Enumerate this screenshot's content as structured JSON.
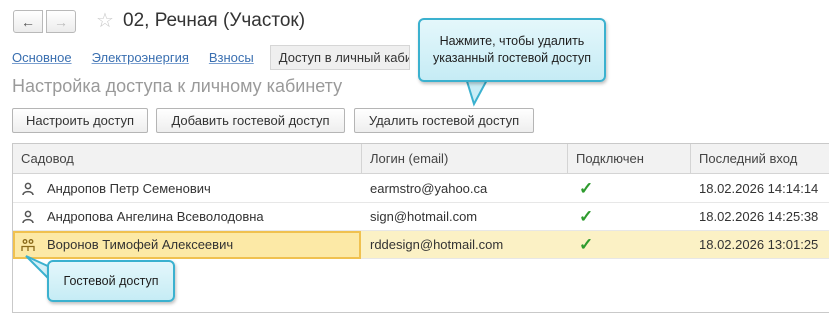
{
  "window": {
    "title": "02, Речная (Участок)",
    "back_icon": "←",
    "forward_icon": "→",
    "star_icon": "☆"
  },
  "tabs": [
    {
      "label": "Основное"
    },
    {
      "label": "Электроэнергия"
    },
    {
      "label": "Взносы"
    },
    {
      "label": "Доступ в личный кабинет"
    }
  ],
  "section_title": "Настройка доступа к личному кабинету",
  "toolbar": {
    "configure_label": "Настроить доступ",
    "add_guest_label": "Добавить гостевой доступ",
    "delete_guest_label": "Удалить гостевой доступ"
  },
  "table": {
    "columns": [
      "Садовод",
      "Логин (email)",
      "Подключен",
      "Последний вход"
    ],
    "rows": [
      {
        "name": "Андропов Петр Семенович",
        "login": "earmstro@yahoo.ca",
        "connected": "✓",
        "last_login": "18.02.2026 14:14:14",
        "icon": "user-icon"
      },
      {
        "name": "Андропова Ангелина Всеволодовна",
        "login": "sign@hotmail.com",
        "connected": "✓",
        "last_login": "18.02.2026 14:25:38",
        "icon": "user-icon"
      },
      {
        "name": "Воронов Тимофей Алексеевич",
        "login": "rddesign@hotmail.com",
        "connected": "✓",
        "last_login": "18.02.2026 13:01:25",
        "icon": "guest-user-icon"
      }
    ]
  },
  "callouts": {
    "delete_hint": "Нажмите, чтобы удалить указанный гостевой доступ",
    "guest_hint": "Гостевой доступ"
  },
  "colors": {
    "selected_row": "#fbf1c5",
    "callout_border": "#3bb1cf",
    "check": "#2e9b2e",
    "link": "#3a6fb0"
  }
}
